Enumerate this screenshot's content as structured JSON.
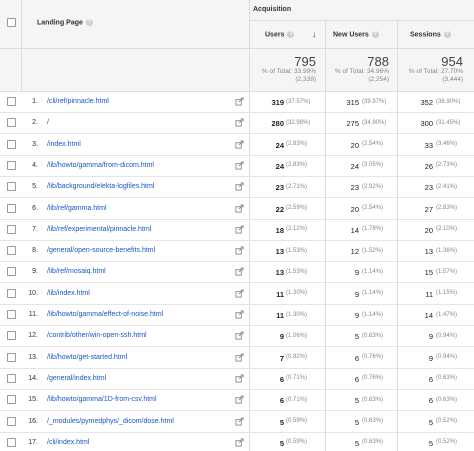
{
  "header": {
    "acquisition": "Acquisition",
    "landing_page": "Landing Page",
    "help_glyph": "?",
    "sort_glyph": "↓",
    "columns": {
      "users": "Users",
      "new_users": "New Users",
      "sessions": "Sessions"
    }
  },
  "totals": {
    "users": {
      "value": "795",
      "line1": "% of Total: 33.99%",
      "line2": "(2,339)"
    },
    "new_users": {
      "value": "788",
      "line1": "% of Total: 34.96%",
      "line2": "(2,254)"
    },
    "sessions": {
      "value": "954",
      "line1": "% of Total: 27.70%",
      "line2": "(3,444)"
    }
  },
  "rows": [
    {
      "idx": "1.",
      "page": "/cli/ref/pinnacle.html",
      "users": "319",
      "users_pct": "(37.57%)",
      "new_users": "315",
      "new_users_pct": "(39.97%)",
      "sessions": "352",
      "sessions_pct": "(36.90%)"
    },
    {
      "idx": "2.",
      "page": "/",
      "users": "280",
      "users_pct": "(32.98%)",
      "new_users": "275",
      "new_users_pct": "(34.90%)",
      "sessions": "300",
      "sessions_pct": "(31.45%)"
    },
    {
      "idx": "3.",
      "page": "/index.html",
      "users": "24",
      "users_pct": "(2.83%)",
      "new_users": "20",
      "new_users_pct": "(2.54%)",
      "sessions": "33",
      "sessions_pct": "(3.46%)"
    },
    {
      "idx": "4.",
      "page": "/lib/howto/gamma/from-dicom.html",
      "users": "24",
      "users_pct": "(2.83%)",
      "new_users": "24",
      "new_users_pct": "(3.05%)",
      "sessions": "26",
      "sessions_pct": "(2.73%)"
    },
    {
      "idx": "5.",
      "page": "/lib/background/elekta-logfiles.html",
      "users": "23",
      "users_pct": "(2.71%)",
      "new_users": "23",
      "new_users_pct": "(2.92%)",
      "sessions": "23",
      "sessions_pct": "(2.41%)"
    },
    {
      "idx": "6.",
      "page": "/lib/ref/gamma.html",
      "users": "22",
      "users_pct": "(2.59%)",
      "new_users": "20",
      "new_users_pct": "(2.54%)",
      "sessions": "27",
      "sessions_pct": "(2.83%)"
    },
    {
      "idx": "7.",
      "page": "/lib/ref/experimental/pinnacle.html",
      "users": "18",
      "users_pct": "(2.12%)",
      "new_users": "14",
      "new_users_pct": "(1.78%)",
      "sessions": "20",
      "sessions_pct": "(2.10%)"
    },
    {
      "idx": "8.",
      "page": "/general/open-source-benefits.html",
      "users": "13",
      "users_pct": "(1.53%)",
      "new_users": "12",
      "new_users_pct": "(1.52%)",
      "sessions": "13",
      "sessions_pct": "(1.36%)"
    },
    {
      "idx": "9.",
      "page": "/lib/ref/mosaiq.html",
      "users": "13",
      "users_pct": "(1.53%)",
      "new_users": "9",
      "new_users_pct": "(1.14%)",
      "sessions": "15",
      "sessions_pct": "(1.57%)"
    },
    {
      "idx": "10.",
      "page": "/lib/index.html",
      "users": "11",
      "users_pct": "(1.30%)",
      "new_users": "9",
      "new_users_pct": "(1.14%)",
      "sessions": "11",
      "sessions_pct": "(1.15%)"
    },
    {
      "idx": "11.",
      "page": "/lib/howto/gamma/effect-of-noise.html",
      "users": "11",
      "users_pct": "(1.30%)",
      "new_users": "9",
      "new_users_pct": "(1.14%)",
      "sessions": "14",
      "sessions_pct": "(1.47%)"
    },
    {
      "idx": "12.",
      "page": "/contrib/other/win-open-ssh.html",
      "users": "9",
      "users_pct": "(1.06%)",
      "new_users": "5",
      "new_users_pct": "(0.63%)",
      "sessions": "9",
      "sessions_pct": "(0.94%)"
    },
    {
      "idx": "13.",
      "page": "/lib/howto/get-started.html",
      "users": "7",
      "users_pct": "(0.82%)",
      "new_users": "6",
      "new_users_pct": "(0.76%)",
      "sessions": "9",
      "sessions_pct": "(0.94%)"
    },
    {
      "idx": "14.",
      "page": "/general/index.html",
      "users": "6",
      "users_pct": "(0.71%)",
      "new_users": "6",
      "new_users_pct": "(0.76%)",
      "sessions": "6",
      "sessions_pct": "(0.63%)"
    },
    {
      "idx": "15.",
      "page": "/lib/howto/gamma/1D-from-csv.html",
      "users": "6",
      "users_pct": "(0.71%)",
      "new_users": "5",
      "new_users_pct": "(0.63%)",
      "sessions": "6",
      "sessions_pct": "(0.63%)"
    },
    {
      "idx": "16.",
      "page": "/_modules/pymedphys/_dicom/dose.html",
      "users": "5",
      "users_pct": "(0.59%)",
      "new_users": "5",
      "new_users_pct": "(0.63%)",
      "sessions": "5",
      "sessions_pct": "(0.52%)"
    },
    {
      "idx": "17.",
      "page": "/cli/index.html",
      "users": "5",
      "users_pct": "(0.59%)",
      "new_users": "5",
      "new_users_pct": "(0.63%)",
      "sessions": "5",
      "sessions_pct": "(0.52%)"
    }
  ],
  "colors": {
    "link": "#1a55c8",
    "header_bg": "#f5f5f5",
    "border": "#dddddd"
  }
}
